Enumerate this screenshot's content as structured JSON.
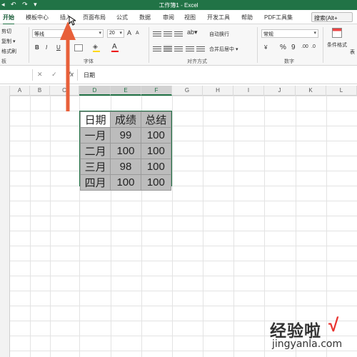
{
  "titlebar": {
    "title": "工作簿1 - Excel",
    "qa_icons": [
      "◂",
      "↶",
      "↷",
      "▾"
    ]
  },
  "tabs": [
    "开始",
    "模板中心",
    "插入",
    "页面布局",
    "公式",
    "数据",
    "审阅",
    "视图",
    "开发工具",
    "帮助",
    "PDF工具集"
  ],
  "active_tab": "开始",
  "search": "搜索(Alt+",
  "ribbon": {
    "clipboard": {
      "cut": "剪切",
      "copy": "复制 ▾",
      "format_painter": "格式刷",
      "label": "板"
    },
    "font": {
      "name": "等线",
      "size": "20",
      "grow": "A",
      "shrink": "A",
      "bold": "B",
      "italic": "I",
      "underline": "U",
      "label": "字体"
    },
    "alignment": {
      "wrap": "自动换行",
      "merge": "合并后居中 ▾",
      "label": "对齐方式"
    },
    "number": {
      "format": "常规",
      "currency": "¥",
      "percent": "%",
      "comma": "9",
      "label": "数字"
    },
    "styles": {
      "conditional": "条件格式",
      "table": "表"
    }
  },
  "formula": {
    "cancel": "✕",
    "enter": "✓",
    "fx": "fx",
    "content": "日期"
  },
  "columns": [
    "A",
    "B",
    "C",
    "D",
    "E",
    "F",
    "G",
    "H",
    "I",
    "J",
    "K",
    "L"
  ],
  "selected_columns": [
    "D",
    "E",
    "F"
  ],
  "table": {
    "headers": [
      "日期",
      "成绩",
      "总结"
    ],
    "rows": [
      [
        "一月",
        "99",
        "100"
      ],
      [
        "二月",
        "100",
        "100"
      ],
      [
        "三月",
        "98",
        "100"
      ],
      [
        "四月",
        "100",
        "100"
      ]
    ]
  },
  "watermark": {
    "text": "经验啦",
    "check": "√",
    "url": "jingyanla.com"
  },
  "colors": {
    "excel_green": "#217346",
    "arrow": "#e8603a",
    "selection_fill": "#bcbcbc"
  }
}
